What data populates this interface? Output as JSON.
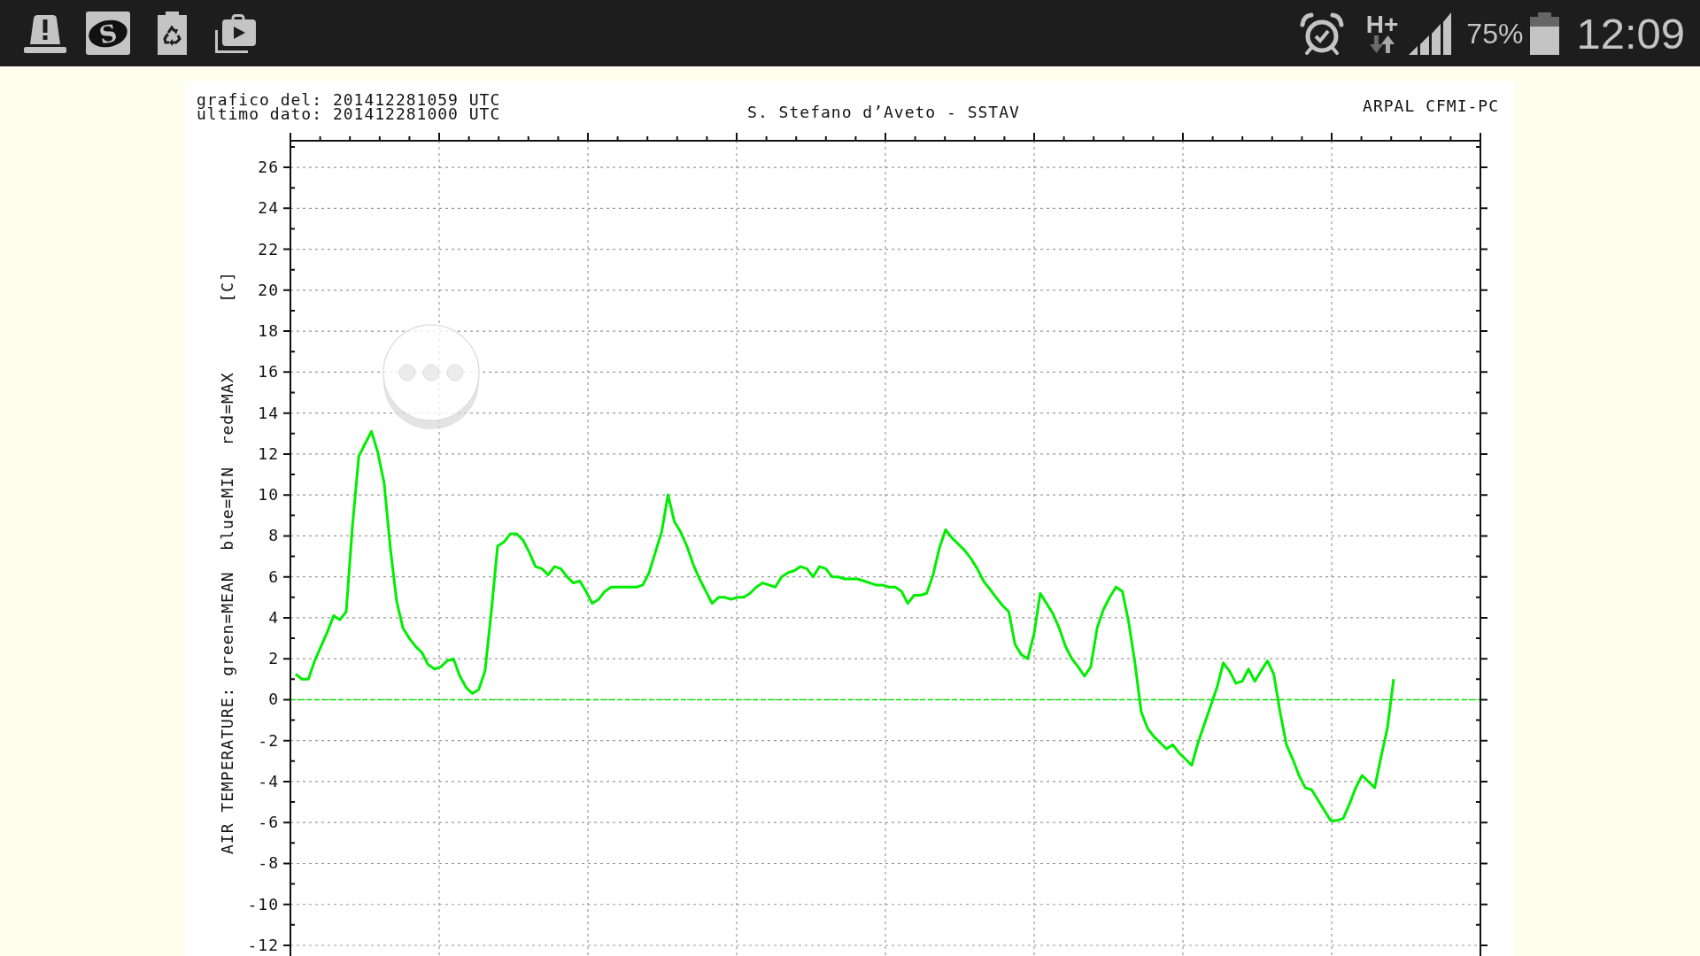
{
  "status_bar": {
    "notifications": [
      {
        "kind": "alert"
      },
      {
        "kind": "letter",
        "text": "S"
      },
      {
        "kind": "battery_recycle"
      },
      {
        "kind": "store"
      }
    ],
    "network_type": "H+",
    "battery": "75%",
    "time": "12:09"
  },
  "chart": {
    "info_lines": [
      "grafico del: 201412281059 UTC",
      "ultimo dato: 201412281000 UTC"
    ],
    "source": "ARPAL CFMI-PC",
    "unit": "[C]",
    "chart_data": {
      "type": "line",
      "title": "S. Stefano d’Aveto - SSTAV",
      "ylabel": "AIR TEMPERATURE: green=MEAN  blue=MIN  red=MAX",
      "grid": true,
      "ylim": [
        -12,
        27.3
      ],
      "yticks": [
        -12,
        -10,
        -8,
        -6,
        -4,
        -2,
        0,
        2,
        4,
        6,
        8,
        10,
        12,
        14,
        16,
        18,
        20,
        22,
        24,
        26
      ],
      "ref_lines": [
        {
          "axis": "y",
          "value": 0,
          "color": "#00ee00"
        }
      ],
      "series": [
        {
          "color": "#00ee00",
          "values": [
            1.25,
            1.0,
            1.0,
            1.9,
            2.6,
            3.3,
            4.1,
            3.9,
            4.3,
            8.5,
            11.9,
            12.5,
            13.1,
            12.1,
            10.6,
            7.4,
            4.8,
            3.5,
            3.0,
            2.6,
            2.3,
            1.7,
            1.5,
            1.6,
            1.9,
            2.0,
            1.15,
            0.6,
            0.3,
            0.5,
            1.4,
            4.3,
            7.5,
            7.7,
            8.1,
            8.1,
            7.8,
            7.2,
            6.5,
            6.4,
            6.1,
            6.5,
            6.4,
            6.0,
            5.7,
            5.8,
            5.3,
            4.7,
            4.9,
            5.3,
            5.5,
            5.5,
            5.5,
            5.5,
            5.5,
            5.6,
            6.2,
            7.2,
            8.2,
            10.0,
            8.7,
            8.2,
            7.5,
            6.6,
            5.9,
            5.3,
            4.7,
            5.0,
            5.0,
            4.9,
            5.0,
            5.0,
            5.2,
            5.5,
            5.7,
            5.6,
            5.5,
            6.0,
            6.2,
            6.3,
            6.5,
            6.4,
            6.0,
            6.5,
            6.4,
            6.0,
            6.0,
            5.9,
            5.9,
            5.9,
            5.8,
            5.7,
            5.6,
            5.6,
            5.5,
            5.5,
            5.3,
            4.7,
            5.1,
            5.1,
            5.2,
            6.1,
            7.4,
            8.3,
            7.9,
            7.6,
            7.3,
            6.9,
            6.4,
            5.8,
            5.4,
            5.0,
            4.6,
            4.3,
            2.7,
            2.2,
            2.0,
            3.2,
            5.2,
            4.7,
            4.2,
            3.5,
            2.6,
            2.0,
            1.6,
            1.15,
            1.6,
            3.5,
            4.4,
            5.0,
            5.5,
            5.3,
            3.8,
            1.8,
            -0.6,
            -1.4,
            -1.8,
            -2.1,
            -2.4,
            -2.2,
            -2.6,
            -2.9,
            -3.2,
            -2.1,
            -1.2,
            -0.3,
            0.6,
            1.8,
            1.4,
            0.8,
            0.9,
            1.5,
            0.9,
            1.4,
            1.9,
            1.25,
            -0.6,
            -2.2,
            -2.9,
            -3.7,
            -4.3,
            -4.4,
            -4.9,
            -5.4,
            -5.9,
            -5.9,
            -5.8,
            -5.1,
            -4.3,
            -3.7,
            -4.0,
            -4.3,
            -2.8,
            -1.4,
            1.0
          ]
        }
      ]
    }
  }
}
